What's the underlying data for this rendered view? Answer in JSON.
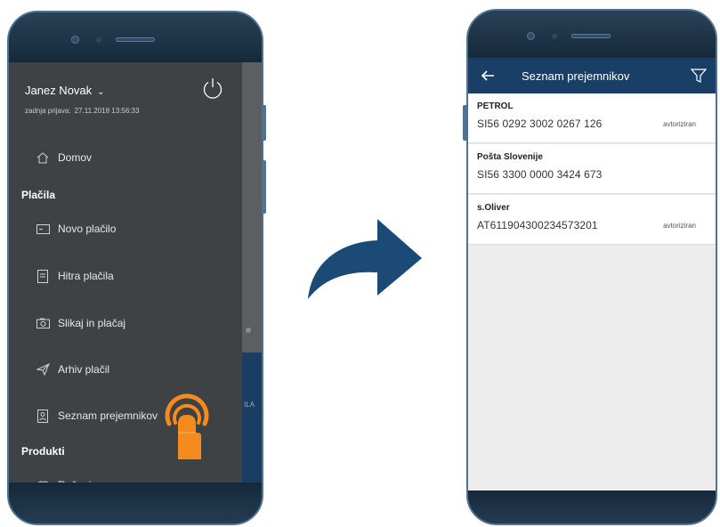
{
  "left_phone": {
    "user": {
      "name": "Janez Novak",
      "last_login_label": "zadnja prijava:",
      "last_login_value": "27.11.2018 13:56:33"
    },
    "menu": {
      "home": "Domov",
      "payments_section": "Plačila",
      "new_payment": "Novo plačilo",
      "quick_payments": "Hitra plačila",
      "scan_and_pay": "Slikaj in plačaj",
      "payment_archive": "Arhiv plačil",
      "recipients": "Seznam prejemnikov",
      "products_section": "Produkti",
      "accounts": "Računi"
    },
    "backdrop_text": "ILA"
  },
  "right_phone": {
    "title": "Seznam prejemnikov",
    "recipients": [
      {
        "name": "PETROL",
        "iban": "SI56 0292 3002 0267 126",
        "status": "avtoriziran"
      },
      {
        "name": "Pošta Slovenije",
        "iban": "SI56 3300 0000 3424 673",
        "status": ""
      },
      {
        "name": "s.Oliver",
        "iban": "AT611904300234573201",
        "status": "avtoriziran"
      }
    ]
  },
  "colors": {
    "drawer": "#3e4244",
    "appbar": "#1a3f66",
    "touch_orange": "#f58a1f",
    "arrow": "#1a4a75"
  },
  "icons": [
    "power-icon",
    "home-icon",
    "card-icon",
    "quick-pay-icon",
    "camera-icon",
    "send-icon",
    "contact-list-icon",
    "coins-icon",
    "back-arrow-icon",
    "filter-icon",
    "curved-arrow-icon",
    "touch-icon"
  ]
}
